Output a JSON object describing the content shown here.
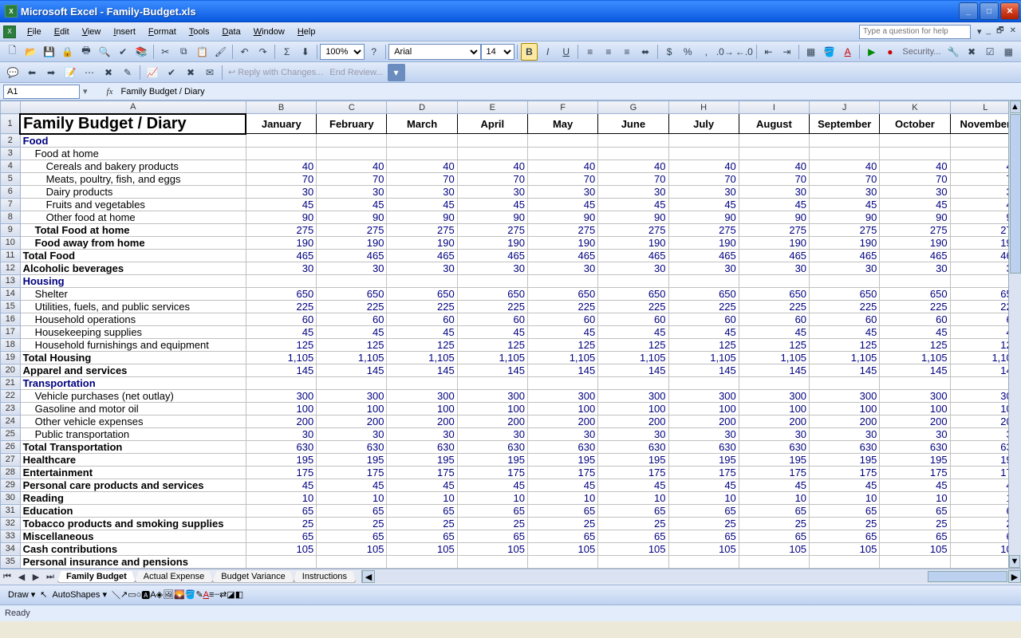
{
  "titlebar": {
    "app": "Microsoft Excel",
    "file": "Family-Budget.xls"
  },
  "menus": [
    "File",
    "Edit",
    "View",
    "Insert",
    "Format",
    "Tools",
    "Data",
    "Window",
    "Help"
  ],
  "help_placeholder": "Type a question for help",
  "toolbar1": {
    "zoom": "100%",
    "font": "Arial",
    "size": "14"
  },
  "review": {
    "reply": "Reply with Changes...",
    "end": "End Review..."
  },
  "security_label": "Security...",
  "namebox": "A1",
  "formula": "Family Budget / Diary",
  "columns": [
    "A",
    "B",
    "C",
    "D",
    "E",
    "F",
    "G",
    "H",
    "I",
    "J",
    "K",
    "L"
  ],
  "months": [
    "January",
    "February",
    "March",
    "April",
    "May",
    "June",
    "July",
    "August",
    "September",
    "October",
    "November"
  ],
  "rows": [
    {
      "n": 1,
      "type": "title",
      "label": "Family Budget / Diary"
    },
    {
      "n": 2,
      "type": "section",
      "label": "Food"
    },
    {
      "n": 3,
      "type": "sub",
      "label": "Food at home"
    },
    {
      "n": 4,
      "type": "subsub",
      "label": "Cereals and bakery products",
      "val": "40"
    },
    {
      "n": 5,
      "type": "subsub",
      "label": "Meats, poultry, fish, and eggs",
      "val": "70"
    },
    {
      "n": 6,
      "type": "subsub",
      "label": "Dairy products",
      "val": "30"
    },
    {
      "n": 7,
      "type": "subsub",
      "label": "Fruits and vegetables",
      "val": "45"
    },
    {
      "n": 8,
      "type": "subsub",
      "label": "Other food at home",
      "val": "90"
    },
    {
      "n": 9,
      "type": "total",
      "label": "Total Food at home",
      "val": "275"
    },
    {
      "n": 10,
      "type": "total",
      "label": "Food away from home",
      "val": "190"
    },
    {
      "n": 11,
      "type": "gtotal",
      "label": "Total Food",
      "val": "465"
    },
    {
      "n": 12,
      "type": "gtotal",
      "label": "Alcoholic beverages",
      "val": "30"
    },
    {
      "n": 13,
      "type": "section",
      "label": "Housing"
    },
    {
      "n": 14,
      "type": "sub",
      "label": "Shelter",
      "val": "650"
    },
    {
      "n": 15,
      "type": "sub",
      "label": "Utilities, fuels, and public services",
      "val": "225"
    },
    {
      "n": 16,
      "type": "sub",
      "label": "Household operations",
      "val": "60"
    },
    {
      "n": 17,
      "type": "sub",
      "label": "Housekeeping supplies",
      "val": "45"
    },
    {
      "n": 18,
      "type": "sub",
      "label": "Household furnishings and equipment",
      "val": "125"
    },
    {
      "n": 19,
      "type": "gtotal",
      "label": "Total Housing",
      "val": "1,105"
    },
    {
      "n": 20,
      "type": "gtotal",
      "label": "Apparel and services",
      "val": "145"
    },
    {
      "n": 21,
      "type": "section",
      "label": "Transportation"
    },
    {
      "n": 22,
      "type": "sub",
      "label": "Vehicle purchases (net outlay)",
      "val": "300"
    },
    {
      "n": 23,
      "type": "sub",
      "label": "Gasoline and motor oil",
      "val": "100"
    },
    {
      "n": 24,
      "type": "sub",
      "label": "Other vehicle expenses",
      "val": "200"
    },
    {
      "n": 25,
      "type": "sub",
      "label": "Public transportation",
      "val": "30"
    },
    {
      "n": 26,
      "type": "gtotal",
      "label": "Total Transportation",
      "val": "630"
    },
    {
      "n": 27,
      "type": "gtotal",
      "label": "Healthcare",
      "val": "195"
    },
    {
      "n": 28,
      "type": "gtotal",
      "label": "Entertainment",
      "val": "175"
    },
    {
      "n": 29,
      "type": "gtotal",
      "label": "Personal care products and services",
      "val": "45"
    },
    {
      "n": 30,
      "type": "gtotal",
      "label": "Reading",
      "val": "10"
    },
    {
      "n": 31,
      "type": "gtotal",
      "label": "Education",
      "val": "65"
    },
    {
      "n": 32,
      "type": "gtotal",
      "label": "Tobacco products and smoking supplies",
      "val": "25"
    },
    {
      "n": 33,
      "type": "gtotal",
      "label": "Miscellaneous",
      "val": "65"
    },
    {
      "n": 34,
      "type": "gtotal",
      "label": "Cash contributions",
      "val": "105"
    },
    {
      "n": 35,
      "type": "gtotal",
      "label": "Personal insurance and pensions"
    }
  ],
  "sheet_tabs": [
    "Family Budget",
    "Actual Expense",
    "Budget Variance",
    "Instructions"
  ],
  "draw": {
    "label": "Draw",
    "autoshapes": "AutoShapes"
  },
  "status": "Ready"
}
